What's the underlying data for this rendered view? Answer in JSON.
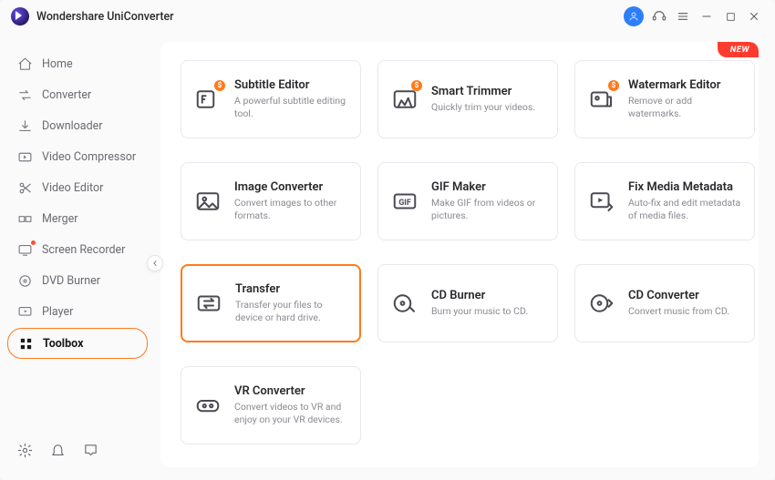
{
  "app": {
    "title": "Wondershare UniConverter"
  },
  "titlebar": {
    "new_badge": "NEW"
  },
  "sidebar": {
    "items": [
      {
        "label": "Home"
      },
      {
        "label": "Converter"
      },
      {
        "label": "Downloader"
      },
      {
        "label": "Video Compressor"
      },
      {
        "label": "Video Editor"
      },
      {
        "label": "Merger"
      },
      {
        "label": "Screen Recorder"
      },
      {
        "label": "DVD Burner"
      },
      {
        "label": "Player"
      },
      {
        "label": "Toolbox"
      }
    ]
  },
  "tools": [
    {
      "title": "Subtitle Editor",
      "desc": "A powerful subtitle editing tool.",
      "sale": "$"
    },
    {
      "title": "Smart Trimmer",
      "desc": "Quickly trim your videos.",
      "sale": "$"
    },
    {
      "title": "Watermark Editor",
      "desc": "Remove or add watermarks.",
      "sale": "$"
    },
    {
      "title": "Image Converter",
      "desc": "Convert images to other formats."
    },
    {
      "title": "GIF Maker",
      "desc": "Make GIF from videos or pictures."
    },
    {
      "title": "Fix Media Metadata",
      "desc": "Auto-fix and edit metadata of media files."
    },
    {
      "title": "Transfer",
      "desc": "Transfer your files to device or hard drive."
    },
    {
      "title": "CD Burner",
      "desc": "Burn your music to CD."
    },
    {
      "title": "CD Converter",
      "desc": "Convert music from CD."
    },
    {
      "title": "VR Converter",
      "desc": "Convert videos to VR and enjoy on your VR devices."
    }
  ]
}
